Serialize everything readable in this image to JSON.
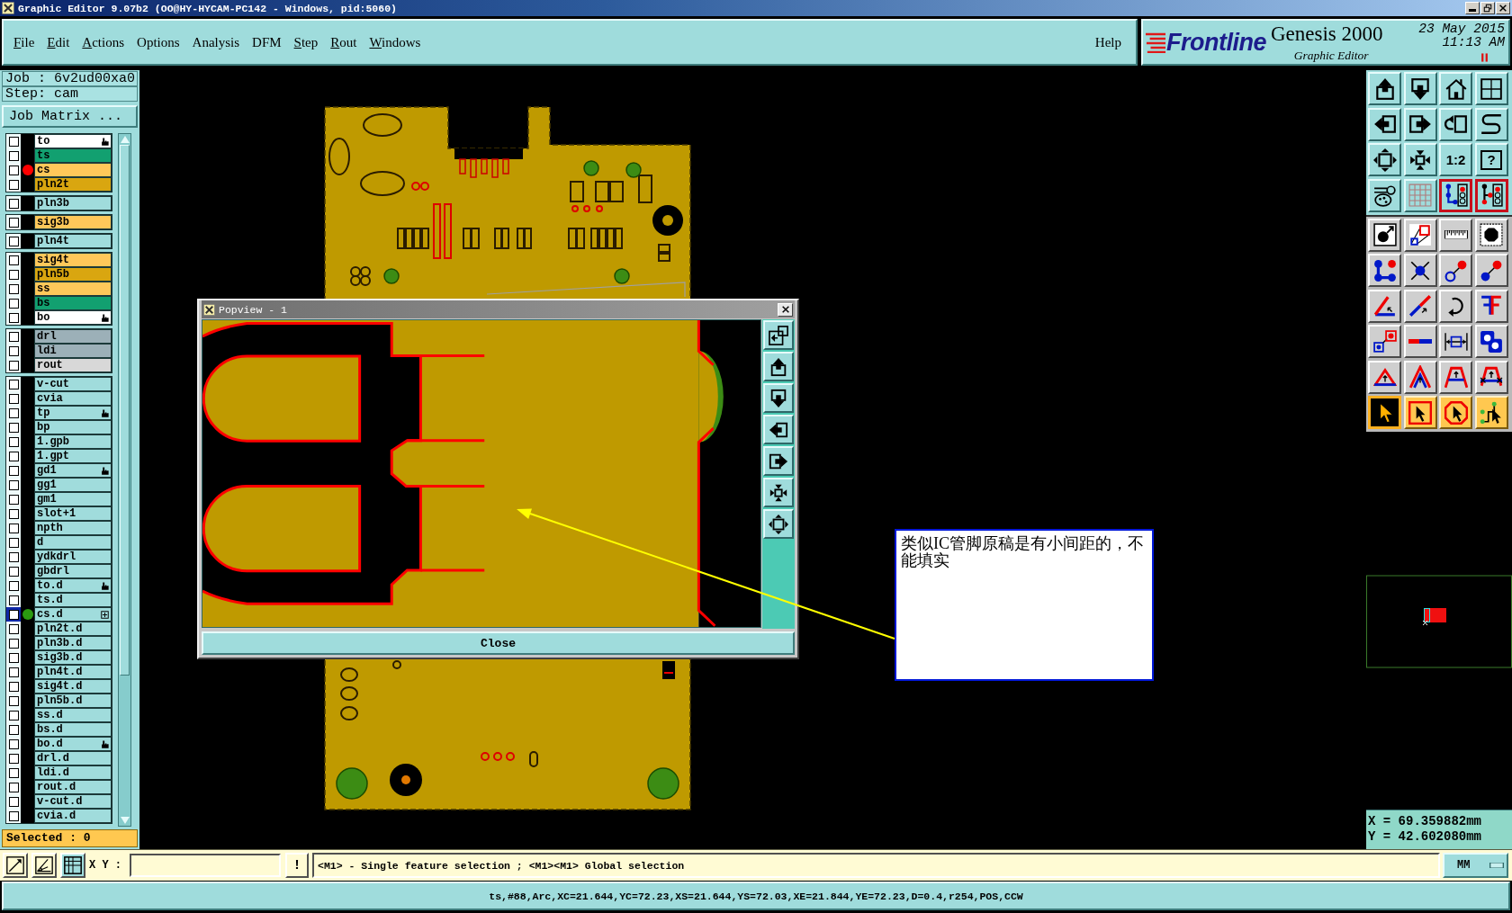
{
  "window": {
    "title": "Graphic Editor 9.07b2 (OO@HY-HYCAM-PC142 - Windows, pid:5060)"
  },
  "menu": {
    "items": [
      {
        "label": "File",
        "mnemonic": true
      },
      {
        "label": "Edit",
        "mnemonic": true
      },
      {
        "label": "Actions",
        "mnemonic": true
      },
      {
        "label": "Options",
        "mnemonic": false
      },
      {
        "label": "Analysis",
        "mnemonic": false
      },
      {
        "label": "DFM",
        "mnemonic": false
      },
      {
        "label": "Step",
        "mnemonic": true
      },
      {
        "label": "Rout",
        "mnemonic": true
      },
      {
        "label": "Windows",
        "mnemonic": true
      }
    ],
    "help": "Help"
  },
  "brand": {
    "logo": "Frontline",
    "product": "Genesis 2000",
    "subtitle": "Graphic Editor",
    "date": "23 May 2015",
    "time": "11:13 AM"
  },
  "job_panel": {
    "job": "Job : 6v2ud00xa0",
    "step": "Step: cam",
    "matrix_button": "Job Matrix ...",
    "layer_groups": [
      {
        "layers": [
          {
            "name": "to",
            "color": "#ffffff",
            "checked": false,
            "selected": false,
            "badge": {
              "kind": "edited"
            }
          },
          {
            "name": "ts",
            "color": "#12a070",
            "checked": false,
            "selected": false
          },
          {
            "name": "cs",
            "color": "#ffc85a",
            "checked": false,
            "selected": false,
            "dot": {
              "color": "#ff0000"
            }
          },
          {
            "name": "pln2t",
            "color": "#d9a610",
            "checked": false,
            "selected": false
          }
        ]
      },
      {
        "layers": [
          {
            "name": "pln3b",
            "color": "#a0dcdc",
            "checked": false,
            "selected": false
          }
        ]
      },
      {
        "layers": [
          {
            "name": "sig3b",
            "color": "#ffc85a",
            "checked": false,
            "selected": false
          }
        ]
      },
      {
        "layers": [
          {
            "name": "pln4t",
            "color": "#a0dcdc",
            "checked": false,
            "selected": false
          }
        ]
      },
      {
        "layers": [
          {
            "name": "sig4t",
            "color": "#ffc85a",
            "checked": false,
            "selected": false
          },
          {
            "name": "pln5b",
            "color": "#d9a610",
            "checked": false,
            "selected": false
          },
          {
            "name": "ss",
            "color": "#ffc85a",
            "checked": false,
            "selected": false
          },
          {
            "name": "bs",
            "color": "#12a070",
            "checked": false,
            "selected": false
          },
          {
            "name": "bo",
            "color": "#ffffff",
            "checked": false,
            "selected": false,
            "badge": {
              "kind": "edited"
            }
          }
        ]
      },
      {
        "layers": [
          {
            "name": "drl",
            "color": "#9cb0b8",
            "checked": false,
            "selected": false
          },
          {
            "name": "ldi",
            "color": "#9cb0b8",
            "checked": false,
            "selected": false
          },
          {
            "name": "rout",
            "color": "#d8d8d8",
            "checked": false,
            "selected": false
          }
        ]
      },
      {
        "layers": [
          {
            "name": "v-cut",
            "color": "#a0dcdc",
            "checked": false,
            "selected": false
          },
          {
            "name": "cvia",
            "color": "#a0dcdc",
            "checked": false,
            "selected": false
          },
          {
            "name": "tp",
            "color": "#a0dcdc",
            "checked": false,
            "selected": false,
            "badge": {
              "kind": "edited"
            }
          },
          {
            "name": "bp",
            "color": "#a0dcdc",
            "checked": false,
            "selected": false
          },
          {
            "name": "1.gpb",
            "color": "#a0dcdc",
            "checked": false,
            "selected": false
          },
          {
            "name": "1.gpt",
            "color": "#a0dcdc",
            "checked": false,
            "selected": false
          },
          {
            "name": "gd1",
            "color": "#a0dcdc",
            "checked": false,
            "selected": false,
            "badge": {
              "kind": "edited"
            }
          },
          {
            "name": "gg1",
            "color": "#a0dcdc",
            "checked": false,
            "selected": false
          },
          {
            "name": "gm1",
            "color": "#a0dcdc",
            "checked": false,
            "selected": false
          },
          {
            "name": "slot+1",
            "color": "#a0dcdc",
            "checked": false,
            "selected": false
          },
          {
            "name": "npth",
            "color": "#a0dcdc",
            "checked": false,
            "selected": false
          },
          {
            "name": "d",
            "color": "#a0dcdc",
            "checked": false,
            "selected": false
          },
          {
            "name": "ydkdrl",
            "color": "#a0dcdc",
            "checked": false,
            "selected": false
          },
          {
            "name": "gbdrl",
            "color": "#a0dcdc",
            "checked": false,
            "selected": false
          },
          {
            "name": "to.d",
            "color": "#a0dcdc",
            "checked": false,
            "selected": false,
            "badge": {
              "kind": "edited"
            }
          },
          {
            "name": "ts.d",
            "color": "#a0dcdc",
            "checked": false,
            "selected": false
          },
          {
            "name": "cs.d",
            "color": "#a0dcdc",
            "checked": false,
            "selected": true,
            "dot": {
              "color": "#2a9a10"
            },
            "badge": {
              "kind": "attached"
            }
          },
          {
            "name": "pln2t.d",
            "color": "#a0dcdc",
            "checked": false,
            "selected": false
          },
          {
            "name": "pln3b.d",
            "color": "#a0dcdc",
            "checked": false,
            "selected": false
          },
          {
            "name": "sig3b.d",
            "color": "#a0dcdc",
            "checked": false,
            "selected": false
          },
          {
            "name": "pln4t.d",
            "color": "#a0dcdc",
            "checked": false,
            "selected": false
          },
          {
            "name": "sig4t.d",
            "color": "#a0dcdc",
            "checked": false,
            "selected": false
          },
          {
            "name": "pln5b.d",
            "color": "#a0dcdc",
            "checked": false,
            "selected": false
          },
          {
            "name": "ss.d",
            "color": "#a0dcdc",
            "checked": false,
            "selected": false
          },
          {
            "name": "bs.d",
            "color": "#a0dcdc",
            "checked": false,
            "selected": false
          },
          {
            "name": "bo.d",
            "color": "#a0dcdc",
            "checked": false,
            "selected": false,
            "badge": {
              "kind": "edited"
            }
          },
          {
            "name": "drl.d",
            "color": "#a0dcdc",
            "checked": false,
            "selected": false
          },
          {
            "name": "ldi.d",
            "color": "#a0dcdc",
            "checked": false,
            "selected": false
          },
          {
            "name": "rout.d",
            "color": "#a0dcdc",
            "checked": false,
            "selected": false
          },
          {
            "name": "v-cut.d",
            "color": "#a0dcdc",
            "checked": false,
            "selected": false
          },
          {
            "name": "cvia.d",
            "color": "#a0dcdc",
            "checked": false,
            "selected": false
          }
        ]
      }
    ],
    "selected_count": "Selected : 0"
  },
  "toolbar": {
    "view_tools": [
      {
        "kind": "up",
        "on": false
      },
      {
        "kind": "down",
        "on": false
      },
      {
        "kind": "home",
        "on": false
      },
      {
        "kind": "window",
        "on": false
      },
      {
        "kind": "left",
        "on": false
      },
      {
        "kind": "right",
        "on": false
      },
      {
        "kind": "undo",
        "on": false
      },
      {
        "kind": "redraw",
        "on": false
      },
      {
        "kind": "fit",
        "on": false
      },
      {
        "kind": "zoom",
        "on": false
      },
      {
        "kind": "scale",
        "label": "1:2",
        "on": false
      },
      {
        "kind": "help",
        "label": "?",
        "on": false
      },
      {
        "kind": "tools",
        "on": false
      },
      {
        "kind": "grid",
        "on": false
      },
      {
        "kind": "snap",
        "on": true
      },
      {
        "kind": "snap2",
        "on": true
      }
    ],
    "edit_tools": [
      {
        "kind": "add"
      },
      {
        "kind": "shape"
      },
      {
        "kind": "ruler"
      },
      {
        "kind": "pad"
      },
      {
        "kind": "connect"
      },
      {
        "kind": "delete"
      },
      {
        "kind": "move"
      },
      {
        "kind": "copy"
      },
      {
        "kind": "angle"
      },
      {
        "kind": "line"
      },
      {
        "kind": "rotate"
      },
      {
        "kind": "mirror"
      },
      {
        "kind": "resize"
      },
      {
        "kind": "split"
      },
      {
        "kind": "measure"
      },
      {
        "kind": "union"
      },
      {
        "kind": "tri"
      },
      {
        "kind": "peak"
      },
      {
        "kind": "trap"
      },
      {
        "kind": "trapx"
      }
    ],
    "select_modes": [
      {
        "kind": "pointer",
        "selected": true
      },
      {
        "kind": "box",
        "selected": false
      },
      {
        "kind": "poly",
        "selected": false
      },
      {
        "kind": "net",
        "selected": false
      }
    ]
  },
  "overview": {
    "x": "X = 69.359882mm",
    "y": "Y = 42.602080mm"
  },
  "popview": {
    "title": "Popview - 1",
    "buttons": [
      {
        "kind": "zoombox"
      },
      {
        "kind": "up"
      },
      {
        "kind": "down"
      },
      {
        "kind": "left"
      },
      {
        "kind": "right"
      },
      {
        "kind": "zoom"
      },
      {
        "kind": "fit"
      }
    ],
    "close": "Close"
  },
  "note": {
    "text": "类似IC管脚原稿是有小间距的，不能填实"
  },
  "status": {
    "tools": [
      {
        "kind": "diagonal",
        "on": false
      },
      {
        "kind": "corner",
        "on": false
      },
      {
        "kind": "crossgrid",
        "on": true
      }
    ],
    "xy_label": "X Y :",
    "bang": "!",
    "message": "<M1> - Single feature selection ; <M1><M1> Global selection",
    "units": "MM",
    "feature_info": "ts,#88,Arc,XC=21.644,YC=72.23,XS=21.644,YS=72.03,XE=21.844,YE=72.23,D=0.4,r254,POS,CCW"
  }
}
